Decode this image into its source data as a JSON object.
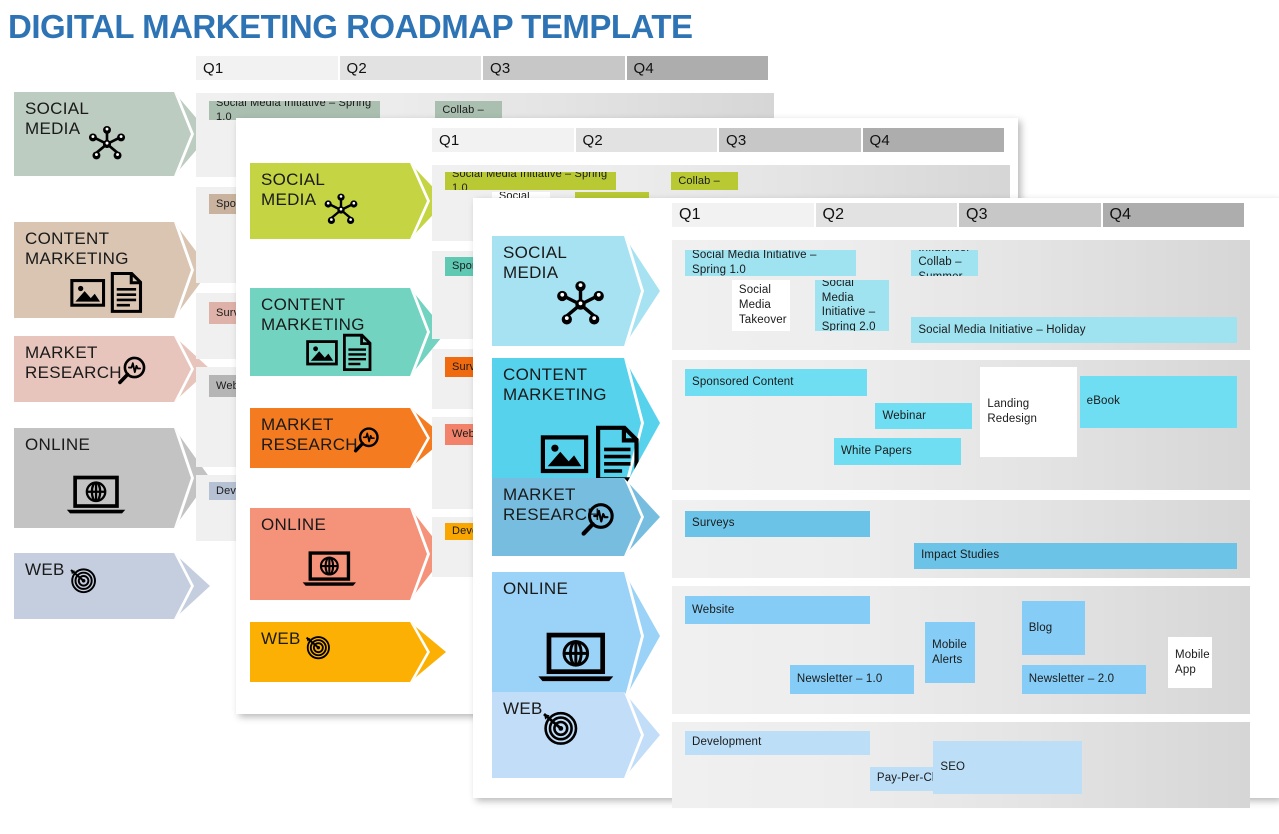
{
  "title": "DIGITAL MARKETING ROADMAP TEMPLATE",
  "title_color": "#2E74B5",
  "quarters": [
    "Q1",
    "Q2",
    "Q3",
    "Q4"
  ],
  "quarter_colors": [
    "#F2F2F2",
    "#E2E2E2",
    "#C7C7C7",
    "#ADADAD"
  ],
  "categories": [
    {
      "label": "SOCIAL\nMEDIA",
      "icon": "network-nodes-icon"
    },
    {
      "label": "CONTENT\nMARKETING",
      "icon": "image-document-icon"
    },
    {
      "label": "MARKET\nRESEARCH",
      "icon": "magnifier-pulse-icon"
    },
    {
      "label": "ONLINE",
      "icon": "laptop-globe-icon"
    },
    {
      "label": "WEB",
      "icon": "target-dart-icon"
    }
  ],
  "cards": [
    {
      "name": "back-card",
      "theme": "muted-earth",
      "label_colors": [
        "#BCCCC0",
        "#D9C5B2",
        "#E8C5BC",
        "#C3C3C3",
        "#C5CEDE"
      ],
      "bar_colors": [
        "#AABFB0",
        "#C9B39E",
        "#DEB2A8",
        "#B5B5B5",
        "#B6C1D4"
      ]
    },
    {
      "name": "middle-card",
      "theme": "bright-warm",
      "label_colors": [
        "#C4D443",
        "#72D3C0",
        "#F47B20",
        "#F5927A",
        "#FBB003"
      ],
      "bar_colors": [
        "#B8C933",
        "#5FC9B4",
        "#F06A10",
        "#F2836A",
        "#F9A600"
      ]
    },
    {
      "name": "front-card",
      "theme": "blue",
      "label_colors": [
        "#A7E2F2",
        "#56D2ED",
        "#77BDE0",
        "#9BD2F7",
        "#C2DDF7"
      ],
      "bar_colors": [
        "#9FE2F0",
        "#6FDDF2",
        "#6BC4E8",
        "#85CDF7",
        "#BDDEF7"
      ]
    }
  ],
  "rows": [
    {
      "category": "SOCIAL MEDIA",
      "items": [
        {
          "text": "Social Media Initiative – Spring 1.0",
          "start": 0.0,
          "span": 0.31,
          "lane": 0,
          "white": false
        },
        {
          "text": "Social Media Takeover",
          "start": 0.085,
          "span": 0.105,
          "lane": 1,
          "white": true
        },
        {
          "text": "Social Media Initiative – Spring 2.0",
          "start": 0.235,
          "span": 0.135,
          "lane": 1,
          "white": false
        },
        {
          "text": "Influencer Collab – Summer",
          "start": 0.41,
          "span": 0.12,
          "lane": 0,
          "white": false
        },
        {
          "text": "Social Media Initiative – Holiday",
          "start": 0.41,
          "span": 0.59,
          "lane": 2,
          "white": false
        }
      ]
    },
    {
      "category": "CONTENT MARKETING",
      "items": [
        {
          "text": "Sponsored Content",
          "start": 0.0,
          "span": 0.33,
          "lane": 0,
          "white": false
        },
        {
          "text": "Webinar",
          "start": 0.345,
          "span": 0.175,
          "lane": 1,
          "white": false
        },
        {
          "text": "White Papers",
          "start": 0.27,
          "span": 0.23,
          "lane": 2,
          "white": false
        },
        {
          "text": "Landing Redesign",
          "start": 0.535,
          "span": 0.175,
          "lane": 3,
          "white": true
        },
        {
          "text": "eBook",
          "start": 0.715,
          "span": 0.285,
          "lane": 4,
          "white": false
        }
      ]
    },
    {
      "category": "MARKET RESEARCH",
      "items": [
        {
          "text": "Surveys",
          "start": 0.0,
          "span": 0.335,
          "lane": 0,
          "white": false
        },
        {
          "text": "Impact Studies",
          "start": 0.415,
          "span": 0.585,
          "lane": 1,
          "white": false
        }
      ]
    },
    {
      "category": "ONLINE",
      "items": [
        {
          "text": "Website",
          "start": 0.0,
          "span": 0.335,
          "lane": 0,
          "white": false
        },
        {
          "text": "Newsletter – 1.0",
          "start": 0.19,
          "span": 0.225,
          "lane": 1,
          "white": false
        },
        {
          "text": "Mobile Alerts",
          "start": 0.435,
          "span": 0.09,
          "lane": 2,
          "white": false
        },
        {
          "text": "Blog",
          "start": 0.61,
          "span": 0.115,
          "lane": 3,
          "white": false
        },
        {
          "text": "Newsletter – 2.0",
          "start": 0.61,
          "span": 0.225,
          "lane": 1,
          "white": false
        },
        {
          "text": "Mobile App",
          "start": 0.875,
          "span": 0.08,
          "lane": 4,
          "white": true
        }
      ]
    },
    {
      "category": "WEB",
      "items": [
        {
          "text": "Development",
          "start": 0.0,
          "span": 0.335,
          "lane": 0,
          "white": false
        },
        {
          "text": "Pay-Per-Click",
          "start": 0.335,
          "span": 0.195,
          "lane": 1,
          "white": false
        },
        {
          "text": "SEO",
          "start": 0.45,
          "span": 0.27,
          "lane": 2,
          "white": false
        }
      ]
    }
  ]
}
